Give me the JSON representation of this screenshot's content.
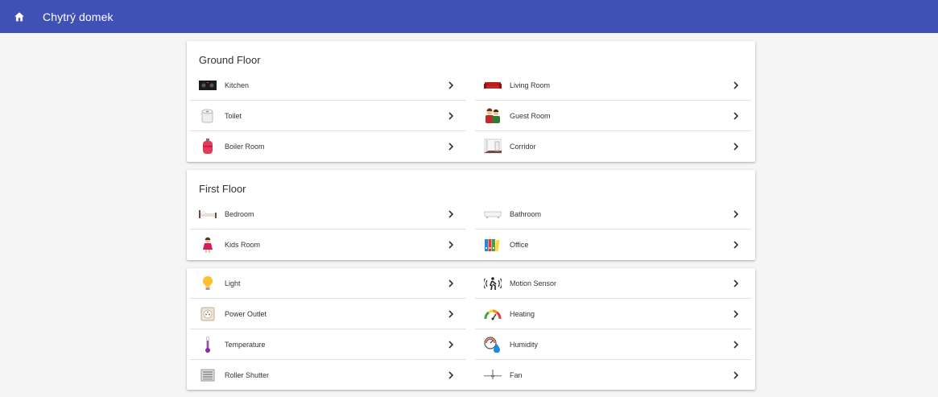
{
  "app": {
    "title": "Chytrý domek",
    "home_icon": "home-icon"
  },
  "colors": {
    "topbar": "#3f51b5",
    "background": "#f5f5f5"
  },
  "ground_floor": {
    "title": "Ground Floor",
    "items": [
      {
        "label": "Kitchen",
        "icon": "stove-icon"
      },
      {
        "label": "Living Room",
        "icon": "sofa-icon"
      },
      {
        "label": "Toilet",
        "icon": "toilet-paper-icon"
      },
      {
        "label": "Guest Room",
        "icon": "guests-icon"
      },
      {
        "label": "Boiler Room",
        "icon": "gas-cylinder-icon"
      },
      {
        "label": "Corridor",
        "icon": "corridor-door-icon"
      }
    ]
  },
  "first_floor": {
    "title": "First Floor",
    "items": [
      {
        "label": "Bedroom",
        "icon": "bed-icon"
      },
      {
        "label": "Bathroom",
        "icon": "bathtub-icon"
      },
      {
        "label": "Kids Room",
        "icon": "child-icon"
      },
      {
        "label": "Office",
        "icon": "binders-icon"
      }
    ]
  },
  "devices": {
    "items": [
      {
        "label": "Light",
        "icon": "light-bulb-icon"
      },
      {
        "label": "Motion Sensor",
        "icon": "motion-sensor-icon"
      },
      {
        "label": "Power Outlet",
        "icon": "power-outlet-icon"
      },
      {
        "label": "Heating",
        "icon": "heating-gauge-icon"
      },
      {
        "label": "Temperature",
        "icon": "thermometer-icon"
      },
      {
        "label": "Humidity",
        "icon": "humidity-gauge-icon"
      },
      {
        "label": "Roller Shutter",
        "icon": "roller-shutter-icon"
      },
      {
        "label": "Fan",
        "icon": "ceiling-fan-icon"
      }
    ]
  }
}
